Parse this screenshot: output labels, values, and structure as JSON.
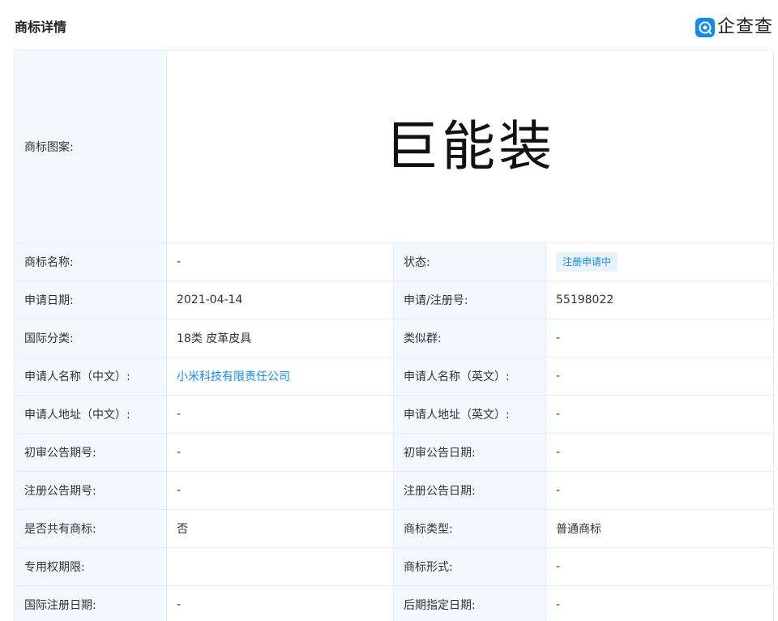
{
  "header": {
    "title": "商标详情",
    "brand": "企查查"
  },
  "trademark": {
    "logo_label": "商标图案:",
    "logo_text": "巨能装"
  },
  "rows": [
    {
      "l1": "商标名称:",
      "v1": "-",
      "l2": "状态:",
      "v2": "注册申请中"
    },
    {
      "l1": "申请日期:",
      "v1": "2021-04-14",
      "l2": "申请/注册号:",
      "v2": "55198022"
    },
    {
      "l1": "国际分类:",
      "v1": "18类 皮革皮具",
      "l2": "类似群:",
      "v2": "-"
    },
    {
      "l1": "申请人名称（中文）:",
      "v1": "小米科技有限责任公司",
      "l2": "申请人名称（英文）:",
      "v2": "-"
    },
    {
      "l1": "申请人地址（中文）:",
      "v1": "-",
      "l2": "申请人地址（英文）:",
      "v2": "-"
    },
    {
      "l1": "初审公告期号:",
      "v1": "-",
      "l2": "初审公告日期:",
      "v2": "-"
    },
    {
      "l1": "注册公告期号:",
      "v1": "-",
      "l2": "注册公告日期:",
      "v2": "-"
    },
    {
      "l1": "是否共有商标:",
      "v1": "否",
      "l2": "商标类型:",
      "v2": "普通商标"
    },
    {
      "l1": "专用权期限:",
      "v1": "",
      "l2": "商标形式:",
      "v2": "-"
    },
    {
      "l1": "国际注册日期:",
      "v1": "-",
      "l2": "后期指定日期:",
      "v2": "-"
    }
  ],
  "colors": {
    "accent": "#128bed",
    "label_bg": "#f2f8fe",
    "border": "#e4eef6"
  }
}
